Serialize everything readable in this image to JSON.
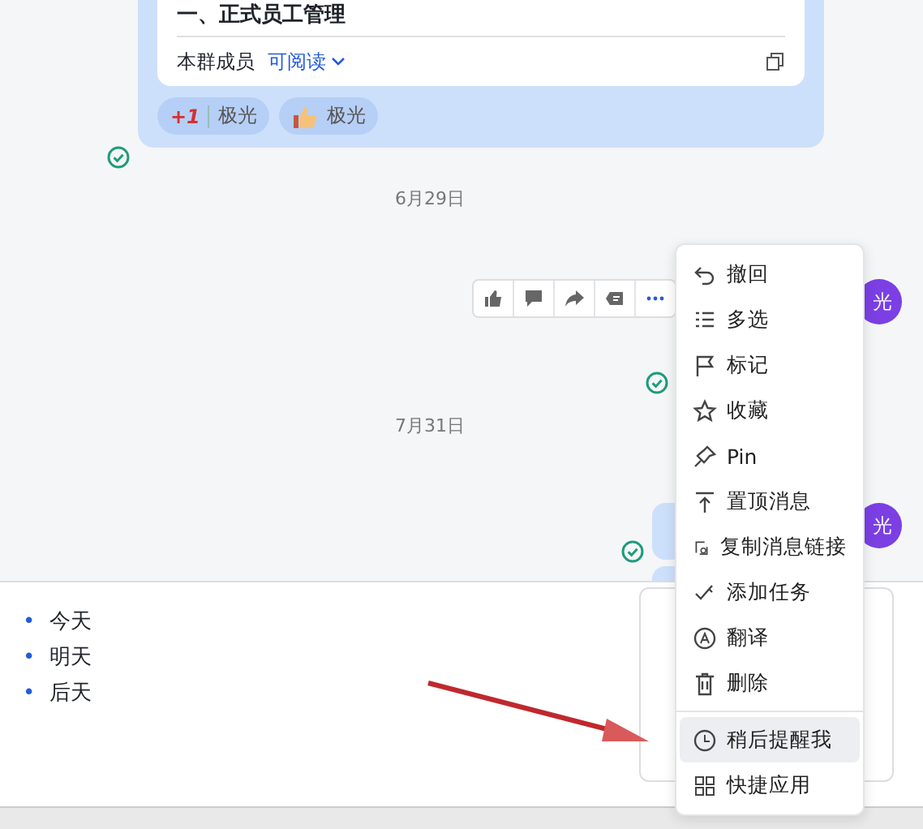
{
  "message_card": {
    "title": "一、正式员工管理",
    "permission_label": "本群成员",
    "permission_value": "可阅读"
  },
  "reactions": [
    {
      "kind": "plus-one",
      "emoji": "+1",
      "user": "极光"
    },
    {
      "kind": "thumbs-up",
      "user": "极光"
    }
  ],
  "dates": [
    "6月29日",
    "7月31日"
  ],
  "avatars": [
    "光",
    "光"
  ],
  "context_menu": {
    "items": [
      {
        "kind": "undo",
        "label": "撤回",
        "selected": false
      },
      {
        "kind": "multi",
        "label": "多选",
        "selected": false
      },
      {
        "kind": "flag",
        "label": "标记",
        "selected": false
      },
      {
        "kind": "star",
        "label": "收藏",
        "selected": false
      },
      {
        "kind": "pin",
        "label": "Pin",
        "selected": false
      },
      {
        "kind": "top",
        "label": "置顶消息",
        "selected": false
      },
      {
        "kind": "link",
        "label": "复制消息链接",
        "selected": false
      },
      {
        "kind": "task",
        "label": "添加任务",
        "selected": false
      },
      {
        "kind": "translate",
        "label": "翻译",
        "selected": false
      },
      {
        "kind": "delete",
        "label": "删除",
        "selected": false
      },
      {
        "kind": "divider"
      },
      {
        "kind": "remind",
        "label": "稍后提醒我",
        "selected": true
      },
      {
        "kind": "apps",
        "label": "快捷应用",
        "selected": false
      }
    ]
  },
  "composer": {
    "list": [
      {
        "bullet": "•",
        "text": "今天"
      },
      {
        "bullet": "•",
        "text": "明天"
      },
      {
        "bullet": "•",
        "text": "后天"
      }
    ]
  }
}
